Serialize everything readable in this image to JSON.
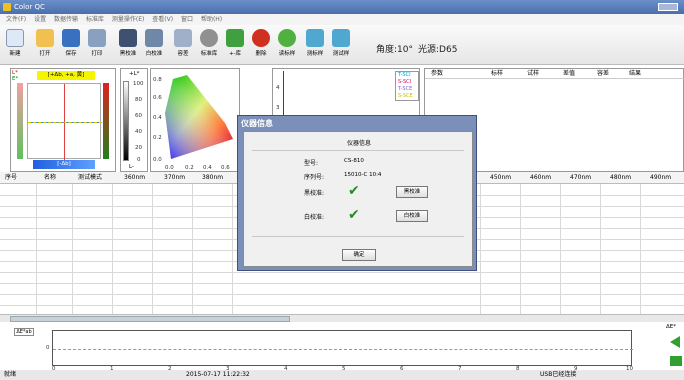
{
  "window": {
    "title": "Color QC"
  },
  "menu": [
    "文件(F)",
    "设置",
    "数据传输",
    "标准库",
    "测量操作(E)",
    "查看(V)",
    "窗口",
    "帮助(H)"
  ],
  "toolbar": {
    "items": [
      {
        "label": "新建",
        "icon": "new-file-icon",
        "color": "#dfe8f5"
      },
      {
        "label": "打开",
        "icon": "open-folder-icon",
        "color": "#f0c050"
      },
      {
        "label": "保存",
        "icon": "save-icon",
        "color": "#3a70c0"
      },
      {
        "label": "打印",
        "icon": "print-icon",
        "color": "#8aa0c0"
      },
      {
        "label": "黑校准",
        "icon": "black-calibration-icon",
        "color": "#405070"
      },
      {
        "label": "白校准",
        "icon": "white-calibration-icon",
        "color": "#7088a8"
      },
      {
        "label": "容差",
        "icon": "tolerance-icon",
        "color": "#a0b0c8"
      },
      {
        "label": "标准库",
        "icon": "standard-library-icon",
        "color": "#909090"
      },
      {
        "label": "+-库",
        "icon": "library-add-remove-icon",
        "color": "#40a040"
      },
      {
        "label": "删除",
        "icon": "delete-icon",
        "color": "#d03020"
      },
      {
        "label": "读标样",
        "icon": "read-standard-icon",
        "color": "#50b040"
      },
      {
        "label": "测标样",
        "icon": "measure-standard-icon",
        "color": "#50a8d0"
      },
      {
        "label": "测试样",
        "icon": "measure-sample-icon",
        "color": "#50a8d0"
      }
    ],
    "angle": "角度:10°",
    "illuminant": "光源:D65"
  },
  "ab_panel": {
    "tag1": "L*",
    "tag2": "E*",
    "legend": "[+Δb, +a, 黄]",
    "bottom": "[-Δb]"
  },
  "l_panel": {
    "header": "+L*",
    "ticks": [
      "100",
      "80",
      "60",
      "40",
      "20",
      "0"
    ],
    "footer": "L-"
  },
  "chroma_panel": {
    "yticks": [
      "0.8",
      "0.6",
      "0.4",
      "0.2",
      "0.0"
    ],
    "xticks": [
      "0.0",
      "0.2",
      "0.4",
      "0.6"
    ]
  },
  "mini_chart": {
    "yticks": [
      "4",
      "3"
    ],
    "legend": [
      "T-SCI",
      "S-SCI",
      "T-SCE",
      "S-SCE"
    ]
  },
  "param_table": {
    "headers": [
      "参数",
      "标样",
      "试样",
      "差值",
      "容差",
      "结果"
    ]
  },
  "main_table": {
    "headers": [
      "序号",
      "名称",
      "测试模式",
      "360nm",
      "370nm",
      "380nm",
      "450nm",
      "460nm",
      "470nm",
      "480nm",
      "490nm"
    ]
  },
  "dialog": {
    "title": "仪器信息",
    "header": "仪器信息",
    "model_label": "型号:",
    "model_value": "CS-810",
    "serial_label": "序列号:",
    "serial_value": "15010-C 10:4",
    "black_label": "黑校准:",
    "white_label": "白校准:",
    "black_btn": "黑校准",
    "white_btn": "白校准",
    "ok": "确定"
  },
  "bottom_chart": {
    "tag": "ΔE*ab",
    "y0": "0",
    "xticks": [
      "0",
      "1",
      "2",
      "3",
      "4",
      "5",
      "6",
      "7",
      "8",
      "9",
      "10"
    ],
    "right_tag": "ΔE*"
  },
  "status": {
    "left": "就绪",
    "time": "2015-07-17 11:22:32",
    "conn": "USB已经连接"
  }
}
